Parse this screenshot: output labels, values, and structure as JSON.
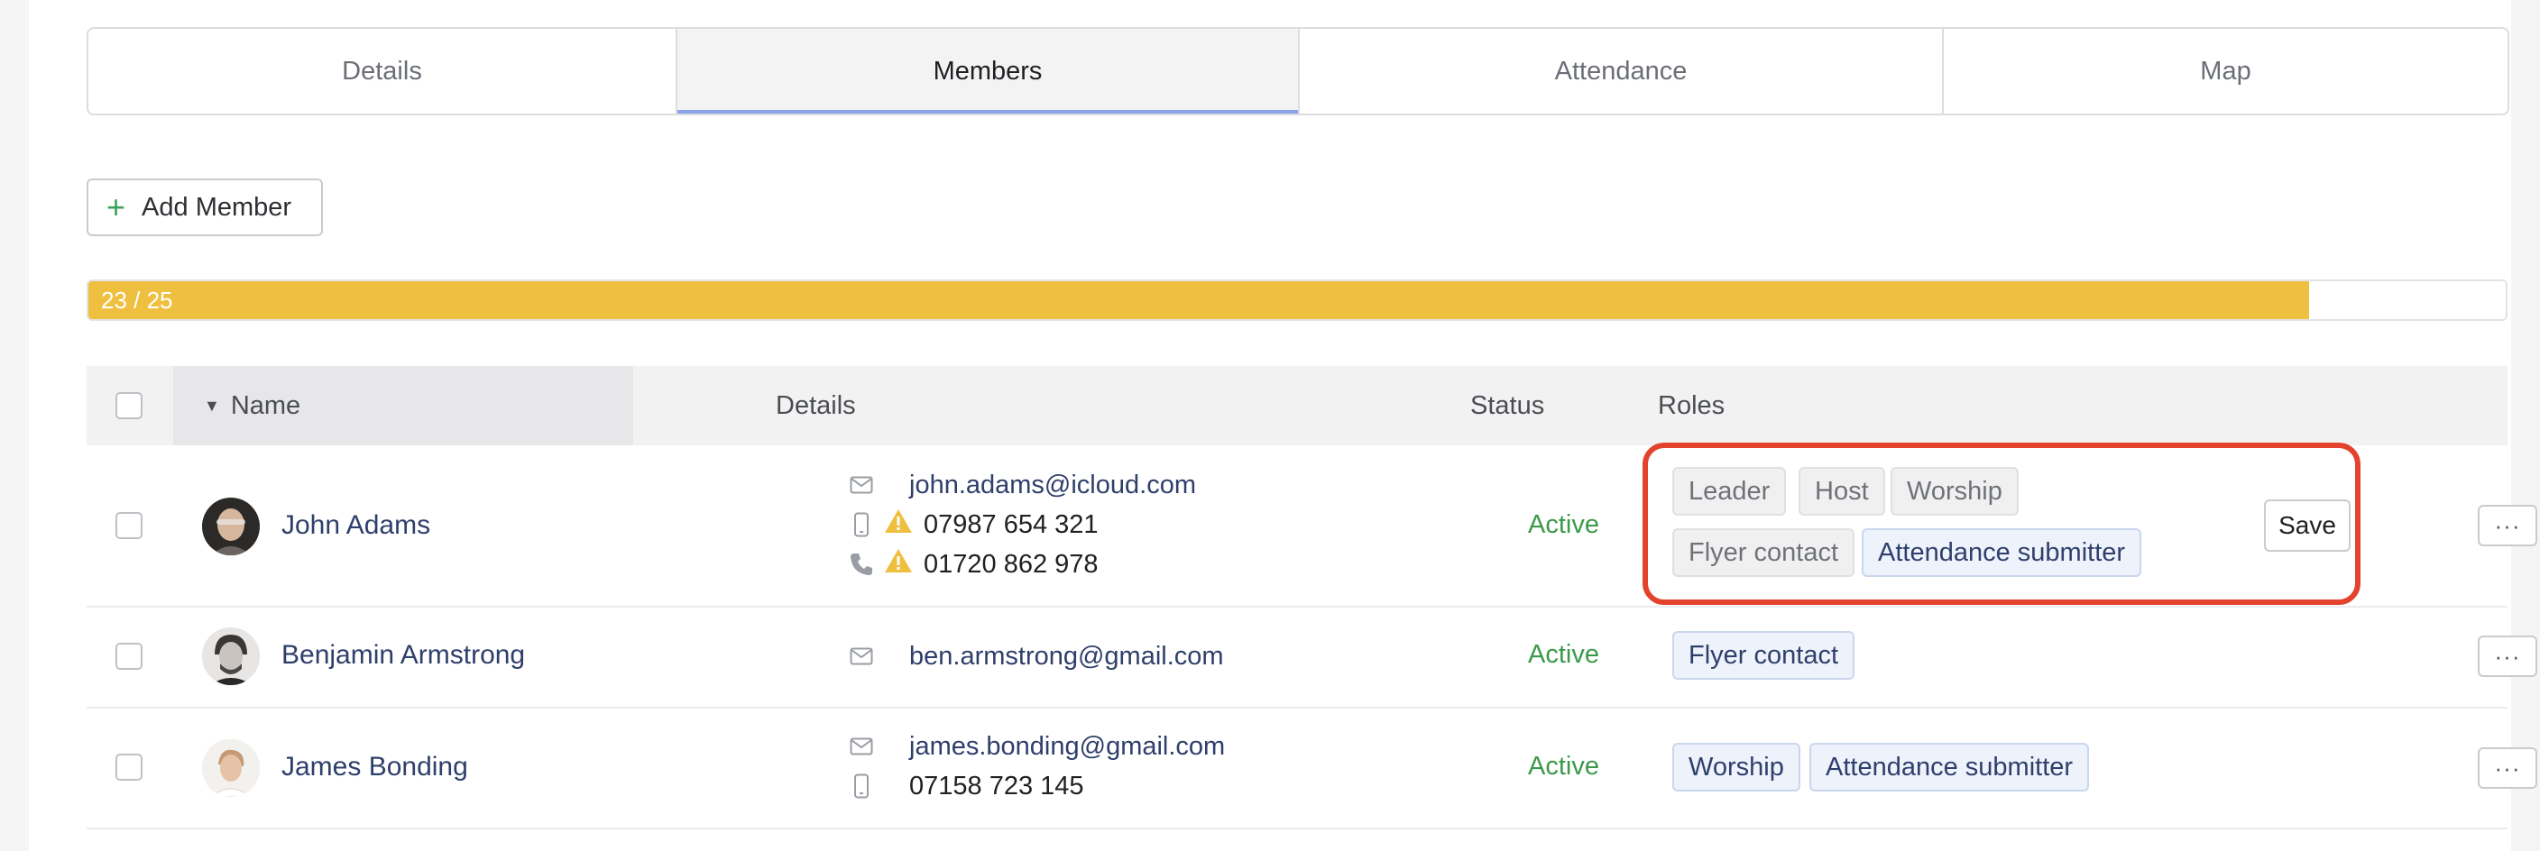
{
  "tabs": [
    {
      "label": "Details"
    },
    {
      "label": "Members"
    },
    {
      "label": "Attendance"
    },
    {
      "label": "Map"
    }
  ],
  "active_tab": "Members",
  "add_member_label": "Add Member",
  "capacity": {
    "text": "23 / 25",
    "filled": 23,
    "total": 25
  },
  "table": {
    "headers": {
      "name": "Name",
      "details": "Details",
      "status": "Status",
      "roles": "Roles"
    },
    "rows": [
      {
        "name": "John Adams",
        "email": "john.adams@icloud.com",
        "mobile": "07987 654 321",
        "phone": "01720 862 978",
        "status": "Active",
        "roles_editing": [
          "Leader",
          "Host",
          "Worship",
          "Flyer contact",
          "Attendance submitter"
        ],
        "roles_selected": [
          "Attendance submitter"
        ],
        "save_label": "Save",
        "more_label": "···"
      },
      {
        "name": "Benjamin Armstrong",
        "email": "ben.armstrong@gmail.com",
        "status": "Active",
        "roles": [
          "Flyer contact"
        ],
        "more_label": "···"
      },
      {
        "name": "James Bonding",
        "email": "james.bonding@gmail.com",
        "mobile": "07158 723 145",
        "status": "Active",
        "roles": [
          "Worship",
          "Attendance submitter"
        ],
        "more_label": "···"
      }
    ]
  },
  "colors": {
    "progress": "#efc040",
    "status_active": "#3a9a4a",
    "link": "#2f3f6b",
    "highlight": "#e3432c",
    "tab_underline": "#8aa5e6"
  },
  "icons": [
    "plus-icon",
    "sort-caret-icon",
    "envelope-icon",
    "mobile-icon",
    "phone-icon",
    "warning-icon",
    "more-icon"
  ]
}
